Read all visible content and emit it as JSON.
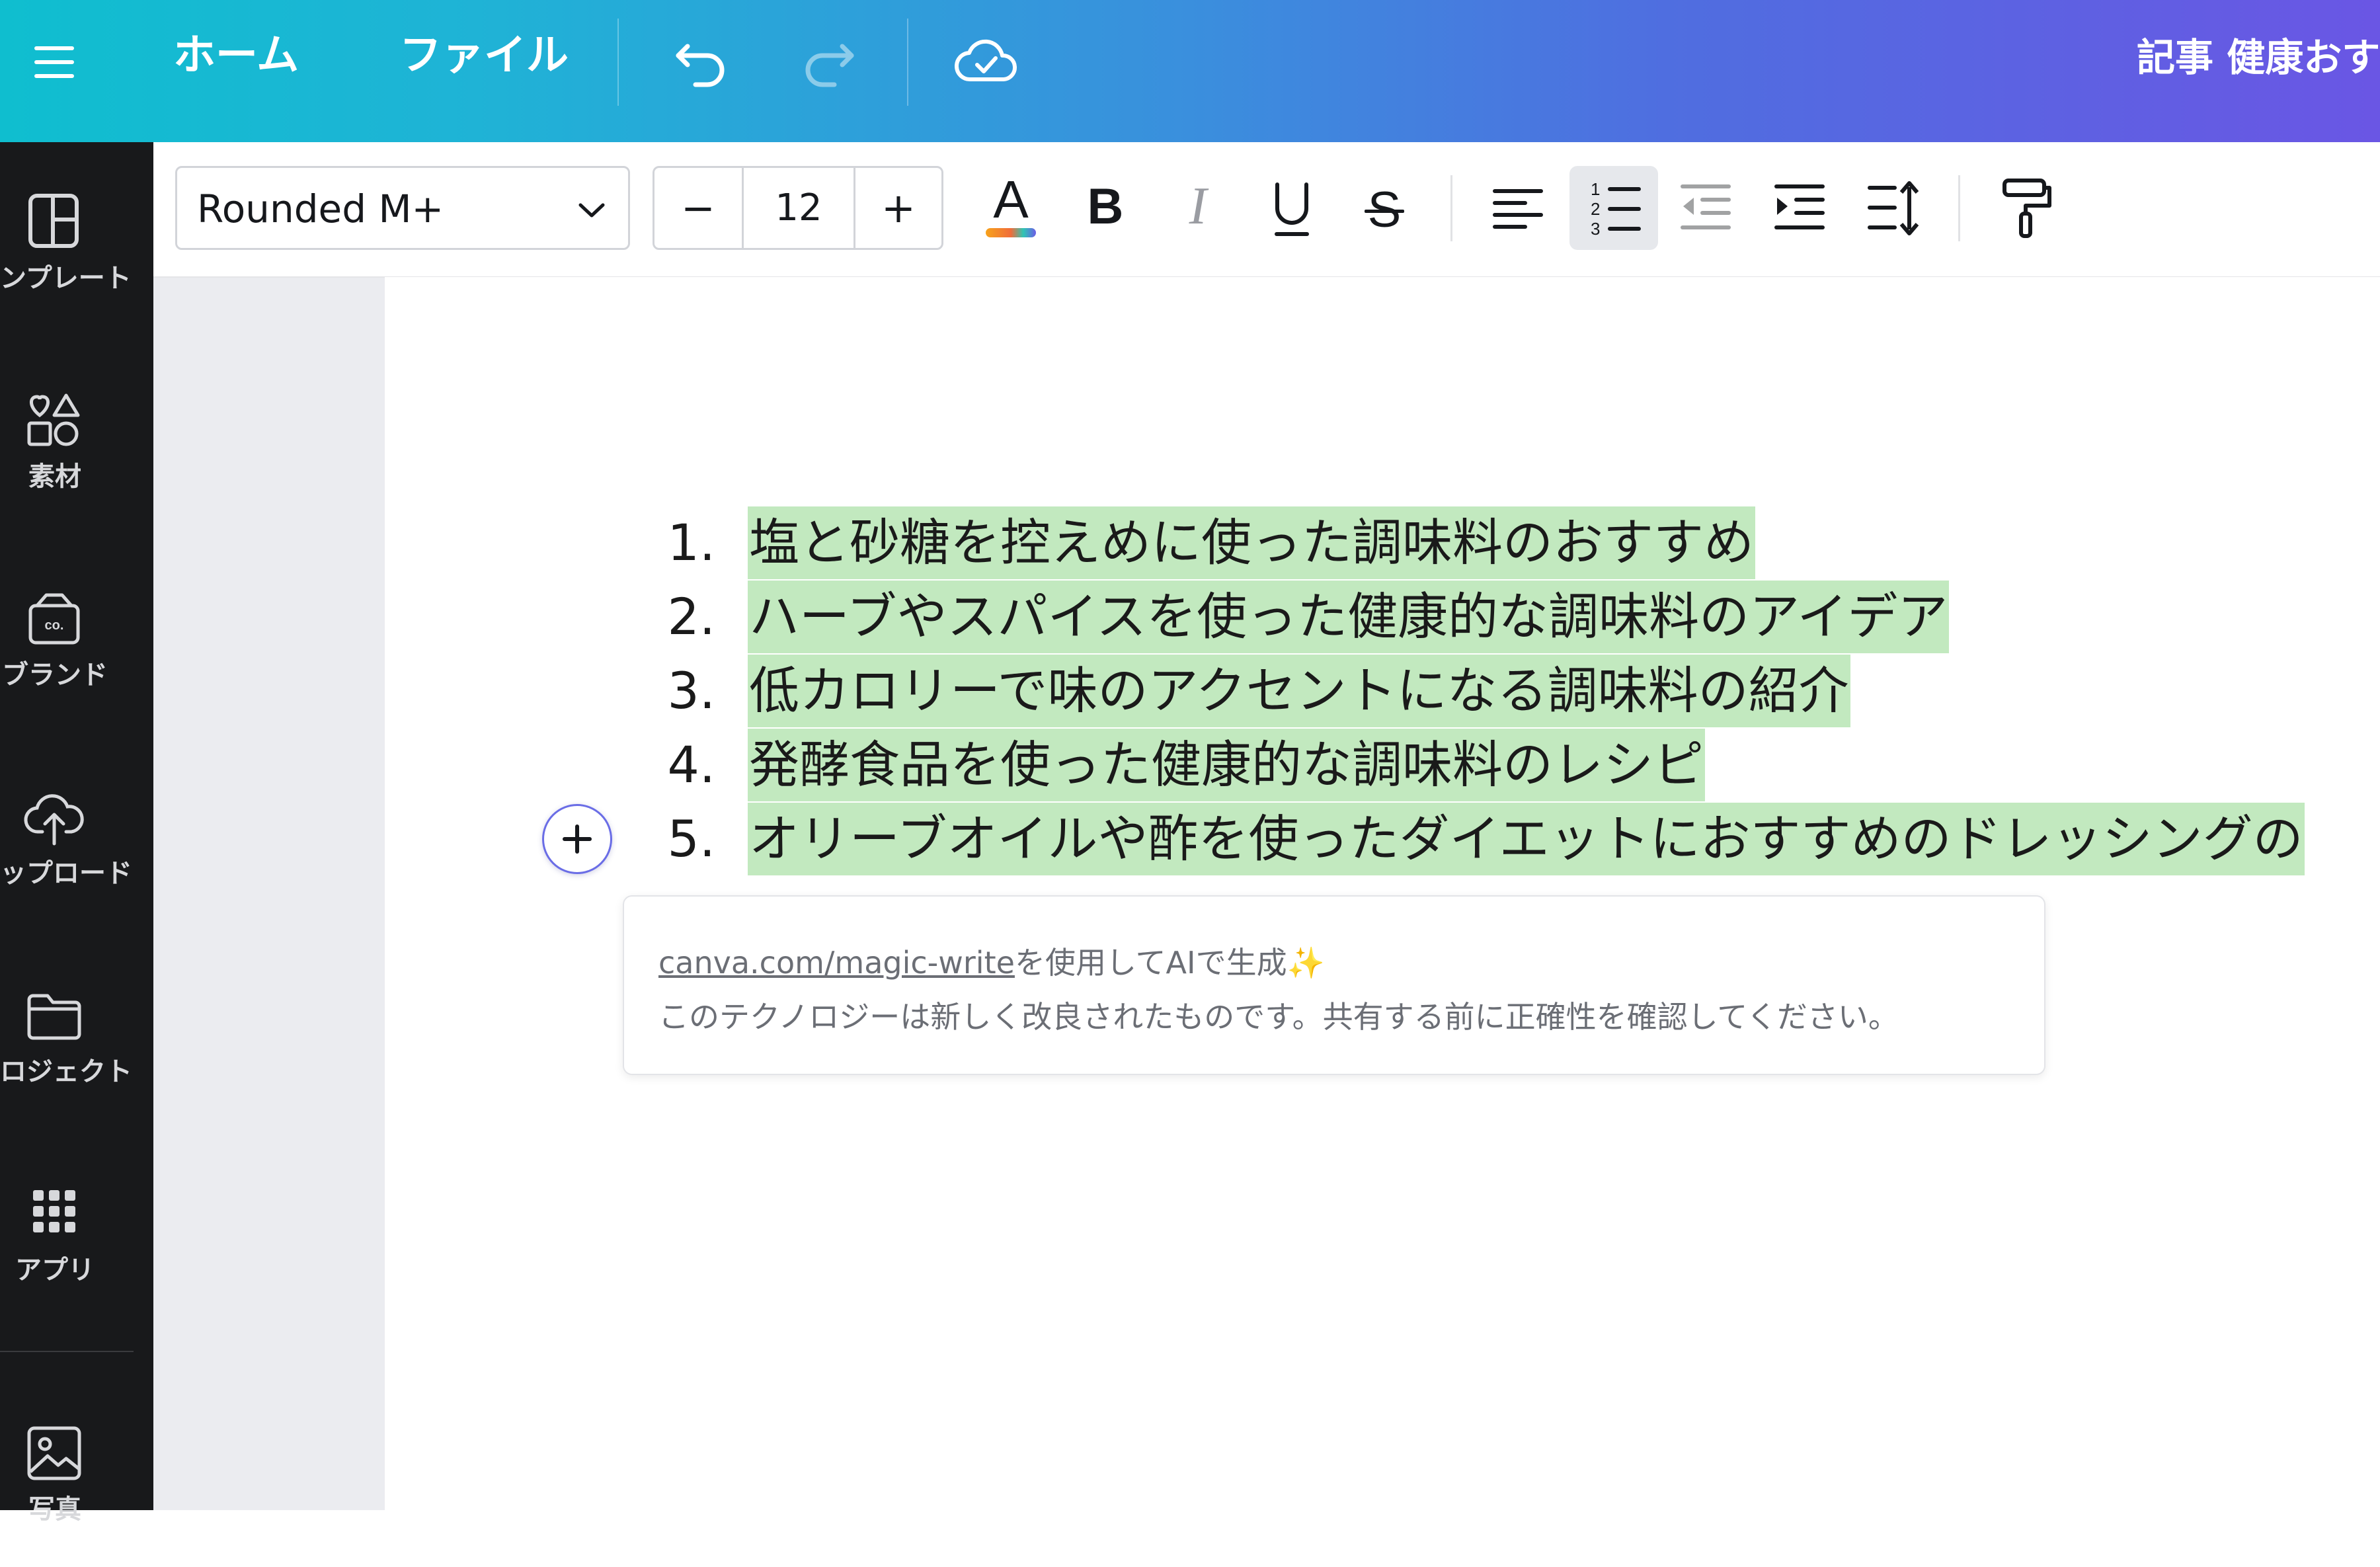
{
  "topbar": {
    "home_label": "ホーム",
    "file_label": "ファイル",
    "doc_title": "記事 健康おす"
  },
  "sidebar": {
    "items": [
      {
        "label": "ンプレート",
        "icon": "template-icon"
      },
      {
        "label": "素材",
        "icon": "elements-icon"
      },
      {
        "label": "ブランド",
        "icon": "brand-icon"
      },
      {
        "label": "ップロード",
        "icon": "upload-icon"
      },
      {
        "label": "ロジェクト",
        "icon": "folder-icon"
      },
      {
        "label": "アプリ",
        "icon": "apps-icon"
      },
      {
        "label": "写真",
        "icon": "photo-icon"
      }
    ]
  },
  "toolbar": {
    "font_name": "Rounded M+",
    "font_size": "12",
    "minus_label": "−",
    "plus_label": "+",
    "text_color_accent": "#f7a21b"
  },
  "document": {
    "list_items": [
      {
        "num": "1.",
        "text": "塩と砂糖を控えめに使った調味料のおすすめ"
      },
      {
        "num": "2.",
        "text": "ハーブやスパイスを使った健康的な調味料のアイデア"
      },
      {
        "num": "3.",
        "text": "低カロリーで味のアクセントになる調味料の紹介"
      },
      {
        "num": "4.",
        "text": "発酵食品を使った健康的な調味料のレシピ"
      },
      {
        "num": "5.",
        "text": "オリーブオイルや酢を使ったダイエットにおすすめのドレッシングの"
      }
    ],
    "highlight_color": "#c2e9bf"
  },
  "magic_write": {
    "link": "canva.com/magic-write",
    "line1_suffix": "を使用してAIで生成",
    "sparkle": "✨",
    "line2": "このテクノロジーは新しく改良されたものです。共有する前に正確性を確認してください。"
  }
}
